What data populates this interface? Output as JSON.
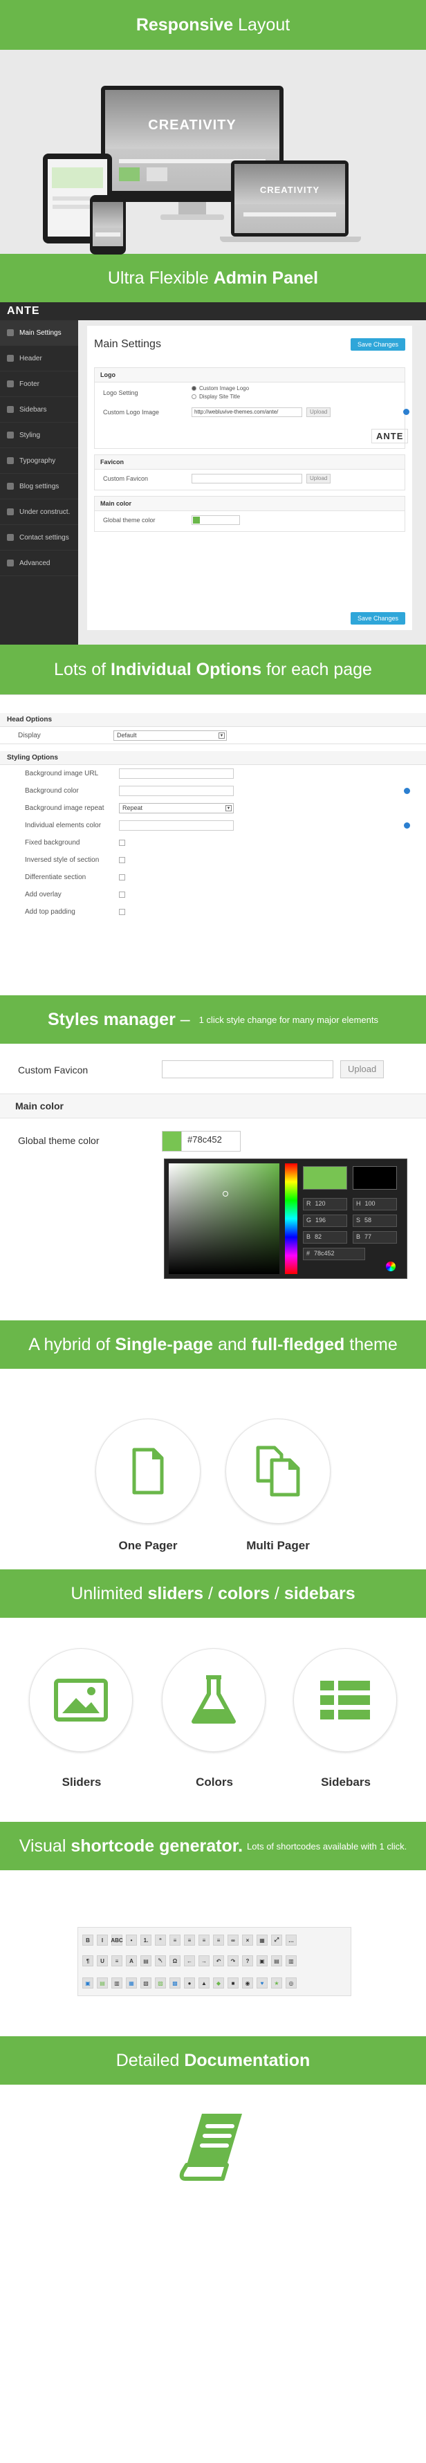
{
  "banners": {
    "responsive": {
      "bold": "Responsive",
      "rest": " Layout"
    },
    "admin": {
      "pre": "Ultra Flexible ",
      "bold": "Admin Panel"
    },
    "options": {
      "pre": "Lots of ",
      "bold": "Individual Options",
      "post": " for each page"
    },
    "styles": {
      "bold": "Styles manager",
      "dash": " – ",
      "small": "1 click style change for many major elements"
    },
    "hybrid": {
      "pre": "A hybrid of ",
      "bold1": "Single-page",
      "mid": " and ",
      "bold2": "full-fledged",
      "post": " theme"
    },
    "unlimited": {
      "pre": "Unlimited ",
      "b1": "sliders",
      "s1": " / ",
      "b2": "colors",
      "s2": " / ",
      "b3": "sidebars"
    },
    "shortcode": {
      "pre": "Visual ",
      "bold": "shortcode generator.",
      "small": "Lots of shortcodes available with 1 click."
    },
    "docs": {
      "pre": "Detailed ",
      "bold": "Documentation"
    }
  },
  "devices": {
    "hero_word": "CREATIVITY",
    "laptop_word": "CREATIVITY"
  },
  "admin": {
    "logo": "ANTE",
    "sidebar": [
      "Main Settings",
      "Header",
      "Footer",
      "Sidebars",
      "Styling",
      "Typography",
      "Blog settings",
      "Under construct.",
      "Contact settings",
      "Advanced"
    ],
    "title": "Main Settings",
    "save": "Save Changes",
    "logo_panel": {
      "header": "Logo",
      "setting_label": "Logo Setting",
      "radio1": "Custom Image Logo",
      "radio2": "Display Site Title",
      "image_label": "Custom Logo Image",
      "image_value": "http://webluvive-themes.com/ante/",
      "upload": "Upload",
      "preview": "ANTE"
    },
    "favicon_panel": {
      "header": "Favicon",
      "label": "Custom Favicon",
      "upload": "Upload"
    },
    "color_panel": {
      "header": "Main color",
      "label": "Global theme color"
    }
  },
  "options": {
    "head_header": "Head Options",
    "display_label": "Display",
    "display_value": "Default",
    "styling_header": "Styling Options",
    "rows": [
      {
        "label": "Background image URL",
        "type": "input"
      },
      {
        "label": "Background color",
        "type": "input"
      },
      {
        "label": "Background image repeat",
        "type": "select",
        "value": "Repeat"
      },
      {
        "label": "Individual elements color",
        "type": "input"
      },
      {
        "label": "Fixed background",
        "type": "check"
      },
      {
        "label": "Inversed style of section",
        "type": "check"
      },
      {
        "label": "Differentiate section",
        "type": "check"
      },
      {
        "label": "Add overlay",
        "type": "check"
      },
      {
        "label": "Add top padding",
        "type": "check"
      }
    ]
  },
  "styles": {
    "favicon_label": "Custom Favicon",
    "upload": "Upload",
    "color_header": "Main color",
    "color_label": "Global theme color",
    "color_value": "#78c452",
    "picker_fields": [
      "R",
      "H",
      "G",
      "S",
      "B",
      "B",
      "#"
    ],
    "picker_values": [
      "120",
      "100",
      "196",
      "58",
      "82",
      "77",
      "78c452"
    ]
  },
  "hybrid": {
    "one": "One Pager",
    "multi": "Multi Pager"
  },
  "unlimited": {
    "sliders": "Sliders",
    "colors": "Colors",
    "sidebars": "Sidebars"
  },
  "toolbar": {
    "row1": [
      "B",
      "I",
      "ABC",
      "•",
      "1.",
      "“",
      "≡",
      "≡",
      "≡",
      "≡",
      "∞",
      "×",
      "▦",
      "⤢",
      "…"
    ],
    "row2": [
      "¶",
      "U",
      "≡",
      "A",
      "▤",
      "␡",
      "Ω",
      "←",
      "→",
      "↶",
      "↷",
      "?",
      "▣",
      "▤",
      "▥"
    ],
    "row3": [
      "▣",
      "▤",
      "▥",
      "▦",
      "▧",
      "▨",
      "▩",
      "●",
      "▲",
      "◆",
      "■",
      "◉",
      "♥",
      "★",
      "◎"
    ]
  },
  "colors": {
    "green": "#6ab74a",
    "blue": "#2fa6d9",
    "dark": "#2b2b2b"
  }
}
